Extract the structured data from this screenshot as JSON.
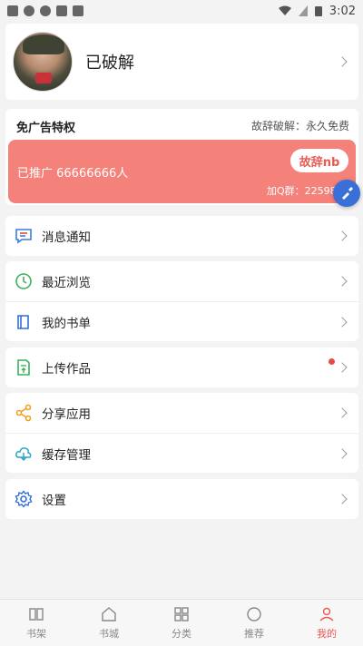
{
  "status_bar": {
    "time": "3:02"
  },
  "profile": {
    "name": "已破解"
  },
  "vip": {
    "title": "免广告特权",
    "right_text": "故辞破解：永久免费",
    "promo_count": "已推广 66666666人",
    "button_label": "故辞nb",
    "qq_group": "加Q群：225988224"
  },
  "menu": {
    "notify": "消息通知",
    "recent": "最近浏览",
    "booklist": "我的书单",
    "upload": "上传作品",
    "share": "分享应用",
    "cache": "缓存管理",
    "settings": "设置"
  },
  "tabs": [
    "书架",
    "书城",
    "分类",
    "推荐",
    "我的"
  ],
  "colors": {
    "accent": "#f5827a",
    "float": "#3b6fd8"
  }
}
